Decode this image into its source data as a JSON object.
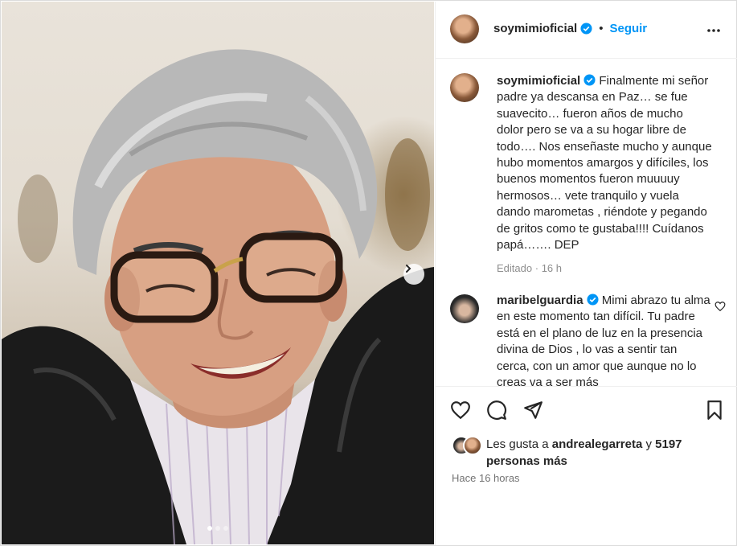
{
  "post": {
    "author": "soymimioficial",
    "follow_label": "Seguir",
    "more_icon": "more-horizontal-icon"
  },
  "caption": {
    "author": "soymimioficial",
    "text": "Finalmente mi señor padre ya descansa en Paz… se fue suavecito… fueron años de mucho dolor pero se va a su hogar libre de todo…. Nos enseñaste mucho y aunque hubo momentos amargos y difíciles, los buenos momentos fueron muuuuy hermosos… vete tranquilo y vuela dando marometas , riéndote y pegando de gritos como te gustaba!!!! Cuídanos papá……. DEP",
    "edited": "Editado",
    "separator": "·",
    "age": "16 h"
  },
  "comment": {
    "author": "maribelguardia",
    "text": "Mimi abrazo tu alma en este momento tan difícil. Tu padre está en el plano de luz en la presencia divina de Dios , lo vas a sentir tan cerca, con un amor que aunque no lo creas va a ser más"
  },
  "likes": {
    "prefix": "Les gusta a",
    "user": "andrealegarreta",
    "connector": "y",
    "count": "5197",
    "suffix": "personas más"
  },
  "timestamp": "Hace 16 horas",
  "colors": {
    "accent": "#0095f6",
    "verified": "#0095f6",
    "text": "#262626",
    "muted": "#8e8e8e"
  }
}
